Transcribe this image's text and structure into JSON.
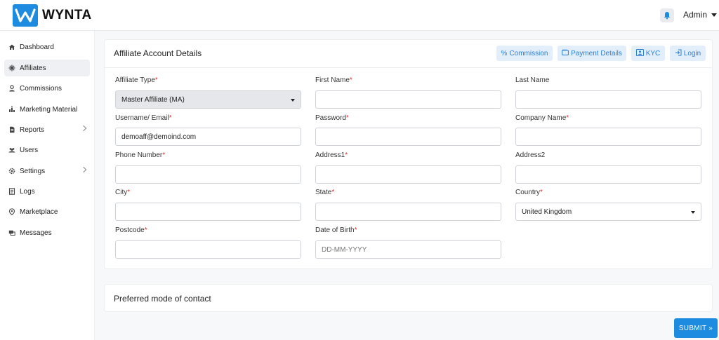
{
  "header": {
    "brand": "WYNTA",
    "user": "Admin"
  },
  "sidebar": {
    "items": [
      {
        "label": "Dashboard",
        "icon": "home-icon"
      },
      {
        "label": "Affiliates",
        "icon": "affiliates-icon",
        "active": true
      },
      {
        "label": "Commissions",
        "icon": "commissions-icon"
      },
      {
        "label": "Marketing Material",
        "icon": "marketing-icon"
      },
      {
        "label": "Reports",
        "icon": "reports-icon",
        "submenu": true
      },
      {
        "label": "Users",
        "icon": "users-icon"
      },
      {
        "label": "Settings",
        "icon": "gear-icon",
        "submenu": true
      },
      {
        "label": "Logs",
        "icon": "logs-icon"
      },
      {
        "label": "Marketplace",
        "icon": "marketplace-icon"
      },
      {
        "label": "Messages",
        "icon": "messages-icon"
      }
    ]
  },
  "account": {
    "title": "Affiliate Account Details",
    "buttons": {
      "commission": "Commission",
      "payment": "Payment Details",
      "kyc": "KYC",
      "login": "Login"
    }
  },
  "form": {
    "affiliate_type": {
      "label": "Affiliate Type",
      "value": "Master Affiliate (MA)"
    },
    "first_name": {
      "label": "First Name",
      "value": ""
    },
    "last_name": {
      "label": "Last Name",
      "value": ""
    },
    "username": {
      "label": "Username/ Email",
      "value": "demoaff@demoind.com"
    },
    "password": {
      "label": "Password",
      "value": ""
    },
    "company": {
      "label": "Company Name",
      "value": ""
    },
    "phone": {
      "label": "Phone Number",
      "value": ""
    },
    "address1": {
      "label": "Address1",
      "value": ""
    },
    "address2": {
      "label": "Address2",
      "value": ""
    },
    "city": {
      "label": "City",
      "value": ""
    },
    "state": {
      "label": "State",
      "value": ""
    },
    "country": {
      "label": "Country",
      "value": "United Kingdom"
    },
    "postcode": {
      "label": "Postcode",
      "value": ""
    },
    "dob": {
      "label": "Date of Birth",
      "placeholder": "DD-MM-YYYY"
    },
    "required_mark": "*"
  },
  "contact": {
    "title": "Preferred mode of contact"
  },
  "submit": {
    "label": "SUBMIT »"
  },
  "colors": {
    "accent": "#1d8ce0",
    "button_bg": "#e3eefb",
    "required": "#d33"
  }
}
